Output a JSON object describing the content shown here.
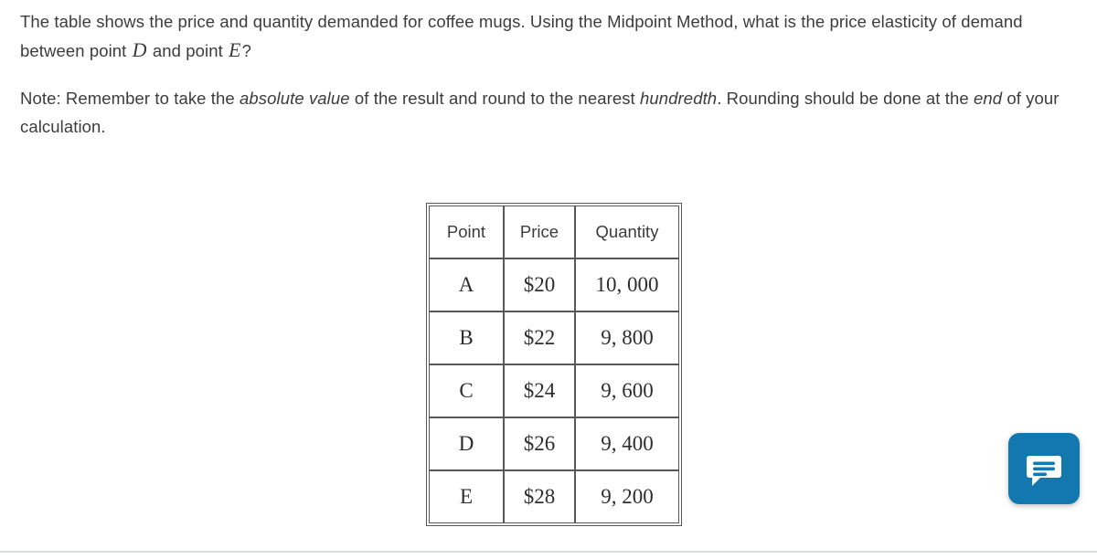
{
  "question": {
    "line1_part1": "The table shows the price and quantity demanded for coffee mugs. Using the Midpoint Method, what is the price",
    "line2_part1": "elasticity of demand between point ",
    "var_d": "D",
    "line2_part2": " and point ",
    "var_e": "E",
    "line2_part3": "?"
  },
  "note": {
    "prefix": "Note: Remember to take the ",
    "italic1": "absolute value",
    "mid1": " of the result and round to the nearest ",
    "italic2": "hundredth",
    "mid2": ". Rounding should be done at the ",
    "italic3": "end",
    "suffix": " of your calculation."
  },
  "table": {
    "headers": [
      "Point",
      "Price",
      "Quantity"
    ],
    "rows": [
      {
        "point": "A",
        "price": "$20",
        "quantity": "10, 000"
      },
      {
        "point": "B",
        "price": "$22",
        "quantity": "9, 800"
      },
      {
        "point": "C",
        "price": "$24",
        "quantity": "9, 600"
      },
      {
        "point": "D",
        "price": "$26",
        "quantity": "9, 400"
      },
      {
        "point": "E",
        "price": "$28",
        "quantity": "9, 200"
      }
    ]
  },
  "chat_widget": {
    "icon": "chat-bubble-icon",
    "color": "#1478b0"
  },
  "colors": {
    "text": "#3c3c3c",
    "table_border": "#58585a",
    "divider": "#d8dce3",
    "accent": "#1478b0"
  }
}
